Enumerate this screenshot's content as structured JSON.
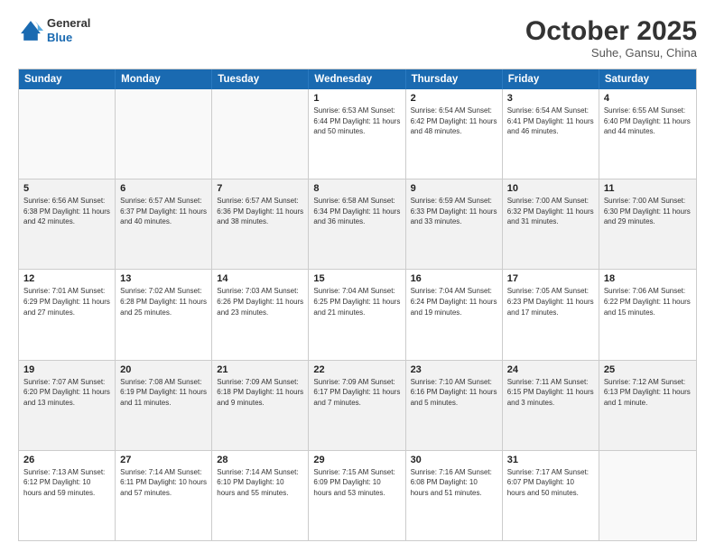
{
  "header": {
    "logo": {
      "general": "General",
      "blue": "Blue"
    },
    "month": "October 2025",
    "location": "Suhe, Gansu, China"
  },
  "weekdays": [
    "Sunday",
    "Monday",
    "Tuesday",
    "Wednesday",
    "Thursday",
    "Friday",
    "Saturday"
  ],
  "rows": [
    [
      {
        "day": "",
        "info": "",
        "empty": true
      },
      {
        "day": "",
        "info": "",
        "empty": true
      },
      {
        "day": "",
        "info": "",
        "empty": true
      },
      {
        "day": "1",
        "info": "Sunrise: 6:53 AM\nSunset: 6:44 PM\nDaylight: 11 hours\nand 50 minutes.",
        "empty": false
      },
      {
        "day": "2",
        "info": "Sunrise: 6:54 AM\nSunset: 6:42 PM\nDaylight: 11 hours\nand 48 minutes.",
        "empty": false
      },
      {
        "day": "3",
        "info": "Sunrise: 6:54 AM\nSunset: 6:41 PM\nDaylight: 11 hours\nand 46 minutes.",
        "empty": false
      },
      {
        "day": "4",
        "info": "Sunrise: 6:55 AM\nSunset: 6:40 PM\nDaylight: 11 hours\nand 44 minutes.",
        "empty": false
      }
    ],
    [
      {
        "day": "5",
        "info": "Sunrise: 6:56 AM\nSunset: 6:38 PM\nDaylight: 11 hours\nand 42 minutes.",
        "empty": false,
        "shaded": true
      },
      {
        "day": "6",
        "info": "Sunrise: 6:57 AM\nSunset: 6:37 PM\nDaylight: 11 hours\nand 40 minutes.",
        "empty": false,
        "shaded": true
      },
      {
        "day": "7",
        "info": "Sunrise: 6:57 AM\nSunset: 6:36 PM\nDaylight: 11 hours\nand 38 minutes.",
        "empty": false,
        "shaded": true
      },
      {
        "day": "8",
        "info": "Sunrise: 6:58 AM\nSunset: 6:34 PM\nDaylight: 11 hours\nand 36 minutes.",
        "empty": false,
        "shaded": true
      },
      {
        "day": "9",
        "info": "Sunrise: 6:59 AM\nSunset: 6:33 PM\nDaylight: 11 hours\nand 33 minutes.",
        "empty": false,
        "shaded": true
      },
      {
        "day": "10",
        "info": "Sunrise: 7:00 AM\nSunset: 6:32 PM\nDaylight: 11 hours\nand 31 minutes.",
        "empty": false,
        "shaded": true
      },
      {
        "day": "11",
        "info": "Sunrise: 7:00 AM\nSunset: 6:30 PM\nDaylight: 11 hours\nand 29 minutes.",
        "empty": false,
        "shaded": true
      }
    ],
    [
      {
        "day": "12",
        "info": "Sunrise: 7:01 AM\nSunset: 6:29 PM\nDaylight: 11 hours\nand 27 minutes.",
        "empty": false
      },
      {
        "day": "13",
        "info": "Sunrise: 7:02 AM\nSunset: 6:28 PM\nDaylight: 11 hours\nand 25 minutes.",
        "empty": false
      },
      {
        "day": "14",
        "info": "Sunrise: 7:03 AM\nSunset: 6:26 PM\nDaylight: 11 hours\nand 23 minutes.",
        "empty": false
      },
      {
        "day": "15",
        "info": "Sunrise: 7:04 AM\nSunset: 6:25 PM\nDaylight: 11 hours\nand 21 minutes.",
        "empty": false
      },
      {
        "day": "16",
        "info": "Sunrise: 7:04 AM\nSunset: 6:24 PM\nDaylight: 11 hours\nand 19 minutes.",
        "empty": false
      },
      {
        "day": "17",
        "info": "Sunrise: 7:05 AM\nSunset: 6:23 PM\nDaylight: 11 hours\nand 17 minutes.",
        "empty": false
      },
      {
        "day": "18",
        "info": "Sunrise: 7:06 AM\nSunset: 6:22 PM\nDaylight: 11 hours\nand 15 minutes.",
        "empty": false
      }
    ],
    [
      {
        "day": "19",
        "info": "Sunrise: 7:07 AM\nSunset: 6:20 PM\nDaylight: 11 hours\nand 13 minutes.",
        "empty": false,
        "shaded": true
      },
      {
        "day": "20",
        "info": "Sunrise: 7:08 AM\nSunset: 6:19 PM\nDaylight: 11 hours\nand 11 minutes.",
        "empty": false,
        "shaded": true
      },
      {
        "day": "21",
        "info": "Sunrise: 7:09 AM\nSunset: 6:18 PM\nDaylight: 11 hours\nand 9 minutes.",
        "empty": false,
        "shaded": true
      },
      {
        "day": "22",
        "info": "Sunrise: 7:09 AM\nSunset: 6:17 PM\nDaylight: 11 hours\nand 7 minutes.",
        "empty": false,
        "shaded": true
      },
      {
        "day": "23",
        "info": "Sunrise: 7:10 AM\nSunset: 6:16 PM\nDaylight: 11 hours\nand 5 minutes.",
        "empty": false,
        "shaded": true
      },
      {
        "day": "24",
        "info": "Sunrise: 7:11 AM\nSunset: 6:15 PM\nDaylight: 11 hours\nand 3 minutes.",
        "empty": false,
        "shaded": true
      },
      {
        "day": "25",
        "info": "Sunrise: 7:12 AM\nSunset: 6:13 PM\nDaylight: 11 hours\nand 1 minute.",
        "empty": false,
        "shaded": true
      }
    ],
    [
      {
        "day": "26",
        "info": "Sunrise: 7:13 AM\nSunset: 6:12 PM\nDaylight: 10 hours\nand 59 minutes.",
        "empty": false
      },
      {
        "day": "27",
        "info": "Sunrise: 7:14 AM\nSunset: 6:11 PM\nDaylight: 10 hours\nand 57 minutes.",
        "empty": false
      },
      {
        "day": "28",
        "info": "Sunrise: 7:14 AM\nSunset: 6:10 PM\nDaylight: 10 hours\nand 55 minutes.",
        "empty": false
      },
      {
        "day": "29",
        "info": "Sunrise: 7:15 AM\nSunset: 6:09 PM\nDaylight: 10 hours\nand 53 minutes.",
        "empty": false
      },
      {
        "day": "30",
        "info": "Sunrise: 7:16 AM\nSunset: 6:08 PM\nDaylight: 10 hours\nand 51 minutes.",
        "empty": false
      },
      {
        "day": "31",
        "info": "Sunrise: 7:17 AM\nSunset: 6:07 PM\nDaylight: 10 hours\nand 50 minutes.",
        "empty": false
      },
      {
        "day": "",
        "info": "",
        "empty": true
      }
    ]
  ]
}
